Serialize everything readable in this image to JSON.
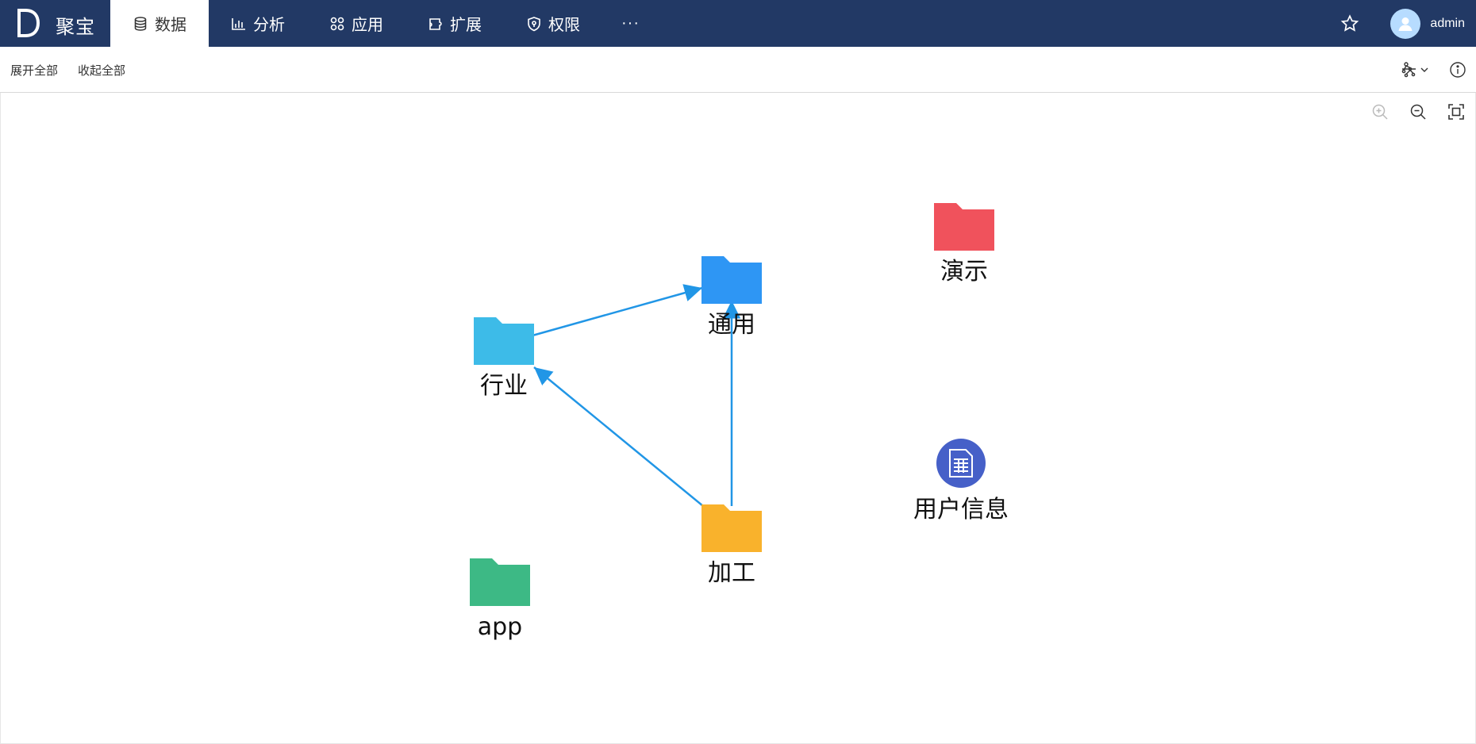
{
  "app": {
    "name": "聚宝",
    "logo_letter": "D"
  },
  "nav": {
    "items": [
      {
        "label": "数据",
        "icon": "database-icon",
        "active": true
      },
      {
        "label": "分析",
        "icon": "bar-chart-icon"
      },
      {
        "label": "应用",
        "icon": "apps-grid-icon"
      },
      {
        "label": "扩展",
        "icon": "puzzle-icon"
      },
      {
        "label": "权限",
        "icon": "shield-icon"
      }
    ],
    "more": "···"
  },
  "user": {
    "name": "admin"
  },
  "toolbar": {
    "expand_all": "展开全部",
    "collapse_all": "收起全部"
  },
  "graph": {
    "nodes": [
      {
        "id": "hangye",
        "label": "行业",
        "type": "folder",
        "color": "#3dbbe8"
      },
      {
        "id": "tongyong",
        "label": "通用",
        "type": "folder",
        "color": "#2e96f4"
      },
      {
        "id": "yanshi",
        "label": "演示",
        "type": "folder",
        "color": "#f0525c"
      },
      {
        "id": "jiagong",
        "label": "加工",
        "type": "folder",
        "color": "#f9b22c"
      },
      {
        "id": "app",
        "label": "app",
        "type": "folder",
        "color": "#3db985"
      },
      {
        "id": "userinfo",
        "label": "用户信息",
        "type": "table",
        "color": "#4660c8"
      }
    ],
    "edges": [
      {
        "from": "hangye",
        "to": "tongyong"
      },
      {
        "from": "jiagong",
        "to": "hangye"
      },
      {
        "from": "jiagong",
        "to": "tongyong"
      }
    ],
    "edge_color": "#2196e6"
  }
}
